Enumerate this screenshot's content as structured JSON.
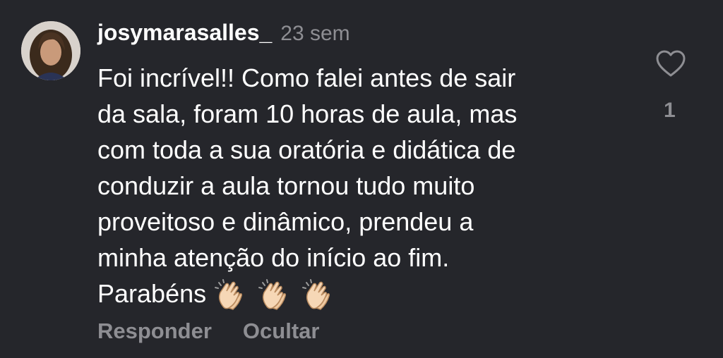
{
  "comment": {
    "username": "josymarasalles_",
    "time": "23 sem",
    "lines": [
      "Foi incrível!! Como falei antes de sair",
      "da sala, foram 10 horas de aula, mas",
      "com toda a sua oratória e didática de",
      "conduzir a aula tornou tudo muito",
      "proveitoso e dinâmico, prendeu a",
      "minha atenção do início ao fim.",
      "Parabéns"
    ],
    "emojis": [
      "clapping-hands-icon",
      "clapping-hands-icon",
      "clapping-hands-icon"
    ]
  },
  "actions": {
    "reply_label": "Responder",
    "hide_label": "Ocultar"
  },
  "like": {
    "icon": "heart-outline-icon",
    "count": "1"
  },
  "colors": {
    "background": "#25262b",
    "text": "#ffffff",
    "muted": "#8e8e93"
  }
}
